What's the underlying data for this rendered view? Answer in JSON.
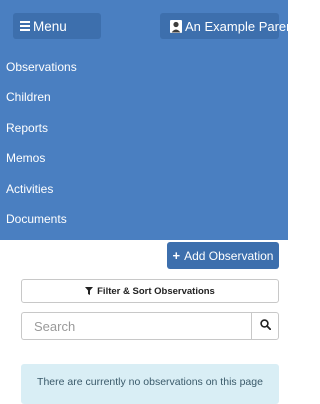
{
  "header": {
    "menu_label": "Menu",
    "user_label": "An Example Parent"
  },
  "nav": {
    "items": [
      {
        "label": "Observations"
      },
      {
        "label": "Children"
      },
      {
        "label": "Reports"
      },
      {
        "label": "Memos"
      },
      {
        "label": "Activities"
      },
      {
        "label": "Documents"
      }
    ]
  },
  "actions": {
    "add_label": "Add Observation",
    "filter_label": "Filter & Sort Observations"
  },
  "search": {
    "placeholder": "Search",
    "value": ""
  },
  "message": {
    "empty_text": "There are currently no observations on this page"
  },
  "colors": {
    "primary": "#4a7fc1",
    "button": "#3d6fad",
    "info_bg": "#d9eef5"
  },
  "icons": [
    "hamburger-icon",
    "user-icon",
    "plus-icon",
    "filter-icon",
    "search-icon"
  ]
}
